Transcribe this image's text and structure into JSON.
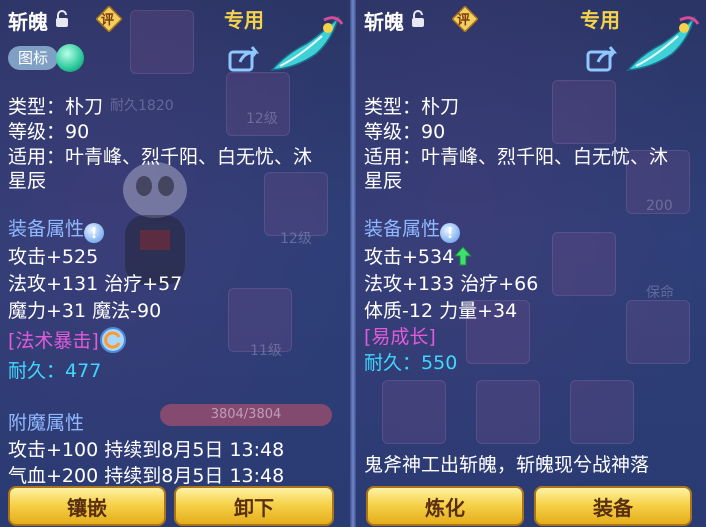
{
  "left_panel": {
    "item_name": "斩魄",
    "rate_icon_text": "评",
    "exclusive_label": "专用",
    "icon_toggle_label": "图标",
    "type_line": "类型：朴刀",
    "level_line": "等级：90",
    "applicable_line1": "适用：叶青峰、烈千阳、白无忧、沐",
    "applicable_line2": "星辰",
    "equip_attr_title": "装备属性",
    "attr_lines": [
      "攻击+525",
      "法攻+131 治疗+57",
      "魔力+31 魔法-90"
    ],
    "special_tag": "[法术暴击]",
    "durability_label": "耐久：",
    "durability_value": "477",
    "enchant_title": "附魔属性",
    "enchant_lines": [
      "攻击+100 持续到8月5日 13:48",
      "气血+200 持续到8月5日 13:48"
    ],
    "hp_text": "3804/3804",
    "hp_fraction": 1.0,
    "buttons": [
      "镶嵌",
      "卸下"
    ],
    "bg_texts": [
      "耐久1820",
      "12级",
      "12级",
      "11级"
    ]
  },
  "right_panel": {
    "item_name": "斩魄",
    "rate_icon_text": "评",
    "exclusive_label": "专用",
    "type_line": "类型：朴刀",
    "level_line": "等级：90",
    "applicable_line1": "适用：叶青峰、烈千阳、白无忧、沐",
    "applicable_line2": "星辰",
    "equip_attr_title": "装备属性",
    "attr_line1": "攻击+534",
    "attr_lines": [
      "法攻+133 治疗+66",
      "体质-12 力量+34"
    ],
    "special_tag": "[易成长]",
    "durability_label": "耐久：",
    "durability_value": "550",
    "description": "鬼斧神工出斩魄，斩魄现兮战神落",
    "buttons": [
      "炼化",
      "装备"
    ],
    "bg_texts": [
      "200",
      "保命"
    ]
  },
  "colors": {
    "section": "#8fb8ff",
    "special": "#e05bd8",
    "durability": "#3ed8ff",
    "exclusive": "#f4d24a"
  },
  "icons": [
    "lock-icon",
    "rate-icon",
    "share-icon",
    "weapon-icon",
    "info-icon",
    "refresh-icon",
    "up-arrow-icon"
  ]
}
